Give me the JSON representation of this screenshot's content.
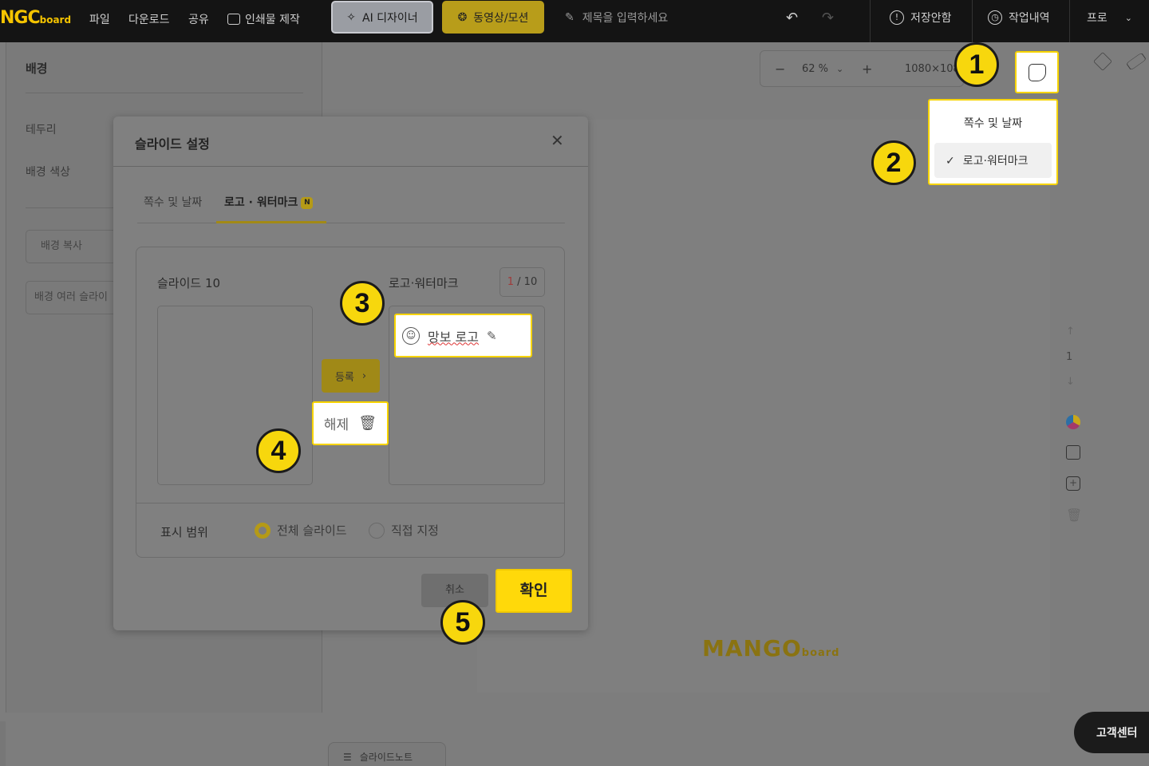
{
  "topbar": {
    "logo_main": "NGC",
    "logo_sub": "board",
    "menu": [
      "파일",
      "다운로드",
      "공유"
    ],
    "print_label": "인쇄물 제작",
    "ai_designer_label": "AI 디자이너",
    "video_motion_label": "동영상/모션",
    "title_placeholder": "제목을 입력하세요",
    "unsaved_label": "저장안함",
    "history_label": "작업내역",
    "profile_label": "프로"
  },
  "left_panel": {
    "heading": "배경",
    "border_label": "테두리",
    "bg_color_label": "배경 색상",
    "copy_bg_button": "배경 복사",
    "multi_slide_button": "배경 여러 슬라이"
  },
  "canvas": {
    "zoom": "62 %",
    "size": "1080×108",
    "logo_main": "MANGO",
    "logo_sub": "board",
    "page_number": "1",
    "slide_note_label": "슬라이드노트",
    "support_label": "고객센터"
  },
  "dropdown": {
    "items": [
      "쪽수 및 날짜",
      "로고·워터마크"
    ],
    "checked_index": 1
  },
  "dialog": {
    "title": "슬라이드 설정",
    "tabs": [
      "쪽수 및 날짜",
      "로고 · 워터마크"
    ],
    "new_badge": "N",
    "slide_label": "슬라이드 10",
    "logo_list_label": "로고·워터마크",
    "counter_current": "1",
    "counter_total": "/ 10",
    "logo_item_name": "망보 로고",
    "register_button": "등록",
    "release_button": "해제",
    "range_label": "표시 범위",
    "range_all": "전체 슬라이드",
    "range_custom": "직접 지정",
    "cancel_button": "취소",
    "confirm_button": "확인"
  },
  "markers": [
    "1",
    "2",
    "3",
    "4",
    "5"
  ],
  "colors": {
    "accent": "#f7d70d",
    "topbar": "#141414",
    "overlay": "#7d7d7d"
  }
}
